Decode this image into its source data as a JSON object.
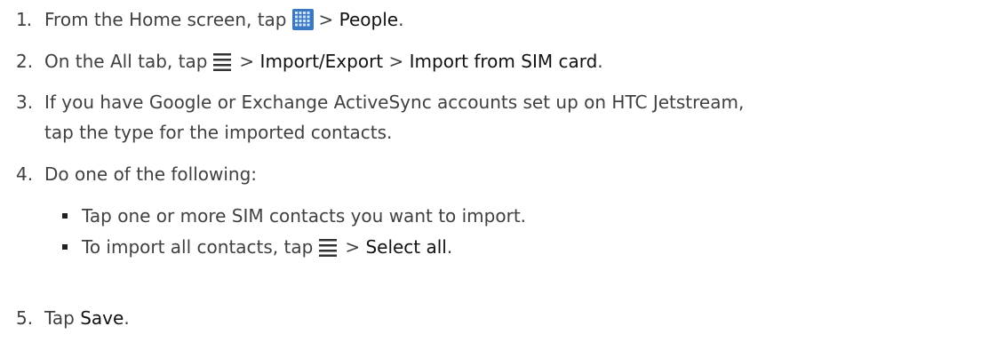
{
  "steps": [
    {
      "number": "1.",
      "before": "From the Home screen, tap",
      "icon": "apps-grid-icon",
      "sep": ">",
      "target": "People",
      "end": "."
    },
    {
      "number": "2.",
      "before": "On the All tab, tap",
      "icon": "menu-icon",
      "sep1": ">",
      "item1": "Import/Export",
      "sep2": ">",
      "item2": "Import from SIM card",
      "end": "."
    },
    {
      "number": "3.",
      "line1": "If you have Google or Exchange ActiveSync accounts set up on HTC Jetstream,",
      "line2": "tap the type for the imported contacts."
    },
    {
      "number": "4.",
      "text": "Do one of the following:",
      "bullets": [
        {
          "text": "Tap one or more SIM contacts you want to import."
        },
        {
          "before": "To import all contacts, tap",
          "icon": "menu-icon",
          "sep": ">",
          "target": "Select all",
          "end": "."
        }
      ]
    },
    {
      "number": "5.",
      "before": "Tap",
      "target": "Save",
      "end": "."
    }
  ],
  "colors": {
    "body_text": "#404040",
    "ui_text": "#111111",
    "apps_icon": "#3a78c4"
  }
}
